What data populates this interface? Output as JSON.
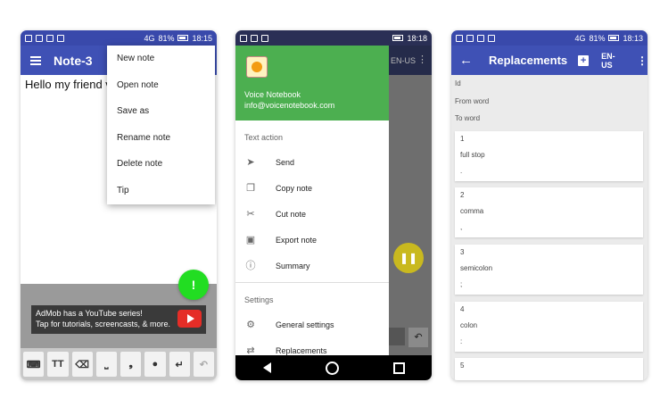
{
  "phone1": {
    "status": {
      "network": "4G",
      "battery": "81%",
      "time": "18:15"
    },
    "title": "Note-3",
    "note_text": "Hello my friend v",
    "menu": [
      "New note",
      "Open note",
      "Save as",
      "Rename note",
      "Delete note",
      "Tip"
    ],
    "ad_text": [
      "AdMob has a YouTube series!",
      "Tap for tutorials, screencasts, & more."
    ],
    "keys": [
      "⌨",
      "TT",
      "⌫",
      "⎵",
      "❟",
      "●",
      "↵",
      "↶"
    ]
  },
  "phone2": {
    "status": {
      "battery": "",
      "time": "18:18"
    },
    "bg_lang": "EN-US",
    "app_name": "Voice Notebook",
    "email": "info@voicenotebook.com",
    "text_action_header": "Text action",
    "items": [
      {
        "icon": "send-icon",
        "label": "Send"
      },
      {
        "icon": "copy-icon",
        "label": "Copy note"
      },
      {
        "icon": "scissors-icon",
        "label": "Cut note"
      },
      {
        "icon": "save-icon",
        "label": "Export note"
      },
      {
        "icon": "info-icon",
        "label": "Summary"
      }
    ],
    "settings_header": "Settings",
    "settings_items": [
      {
        "icon": "gear-icon",
        "label": "General settings"
      },
      {
        "icon": "swap-icon",
        "label": "Replacements"
      }
    ]
  },
  "phone3": {
    "status": {
      "network": "4G",
      "battery": "81%",
      "time": "18:13"
    },
    "title": "Replacements",
    "lang": "EN-US",
    "fields": [
      "Id",
      "From word",
      "To word"
    ],
    "rows": [
      {
        "id": "1",
        "from": "full stop",
        "to": "."
      },
      {
        "id": "2",
        "from": "comma",
        "to": ","
      },
      {
        "id": "3",
        "from": "semicolon",
        "to": ";"
      },
      {
        "id": "4",
        "from": "colon",
        "to": ":"
      },
      {
        "id": "5",
        "from": "",
        "to": ""
      }
    ]
  }
}
